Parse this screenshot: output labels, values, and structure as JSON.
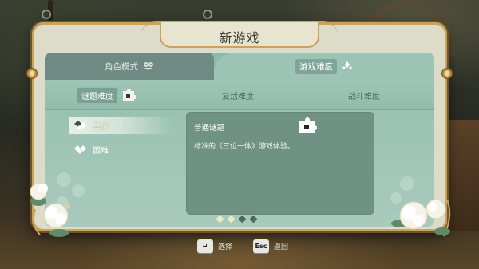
{
  "window": {
    "title": "新游戏"
  },
  "top_tabs": [
    {
      "label": "角色模式",
      "icon": "mask-icon",
      "active": false
    },
    {
      "label": "游戏难度",
      "icon": "diamond-cluster-icon",
      "active": true
    }
  ],
  "sub_tabs": [
    {
      "label": "谜题难度",
      "icon": "puzzle-icon",
      "active": true
    },
    {
      "label": "复活难度",
      "active": false
    },
    {
      "label": "战斗难度",
      "active": false
    }
  ],
  "difficulty_options": [
    {
      "label": "普通",
      "icon": "puzzle-pieces-icon",
      "selected": true
    },
    {
      "label": "困难",
      "icon": "puzzle-pieces-icon",
      "selected": false
    }
  ],
  "detail": {
    "title": "普通谜题",
    "description": "标准的《三位一体》游戏体验。",
    "icon": "puzzle-icon"
  },
  "pagination": {
    "total": 4,
    "current": 2
  },
  "hints": [
    {
      "key": "↵",
      "label": "选择"
    },
    {
      "key": "Esc",
      "label": "返回"
    }
  ],
  "colors": {
    "frame_gold": "#c9a25c",
    "panel_teal": "#9cc3b3",
    "detail_teal": "#6f9285",
    "inactive_tab": "#6f8a82"
  }
}
